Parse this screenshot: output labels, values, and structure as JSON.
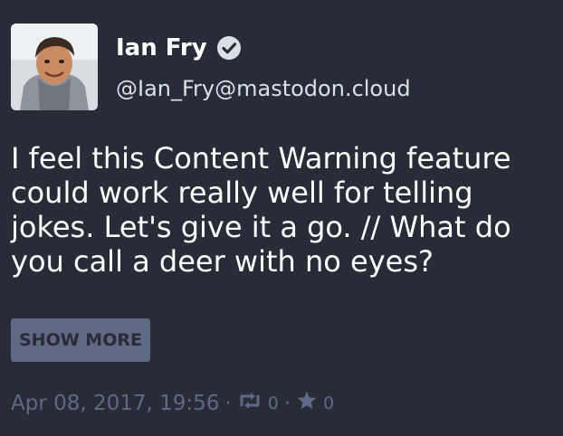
{
  "account": {
    "display_name": "Ian Fry",
    "acct": "@Ian_Fry@mastodon.cloud",
    "verified": true
  },
  "status": {
    "spoiler_text": "I feel this Content Warning feature\ncould work really well for telling\njokes. Let's give it a go. // What do\nyou call a deer with no eyes?",
    "show_more_label": "SHOW MORE",
    "timestamp": "Apr 08, 2017, 19:56",
    "separator": "·",
    "reblogs_count": "0",
    "favourites_count": "0"
  },
  "icons": {
    "verified": "check-circle-icon",
    "reblog": "retweet-icon",
    "favourite": "star-icon"
  },
  "colors": {
    "background": "#282c37",
    "text_primary": "#ffffff",
    "text_secondary": "#d9e1e8",
    "muted": "#606984",
    "verified_badge": "#d9e1e8"
  }
}
